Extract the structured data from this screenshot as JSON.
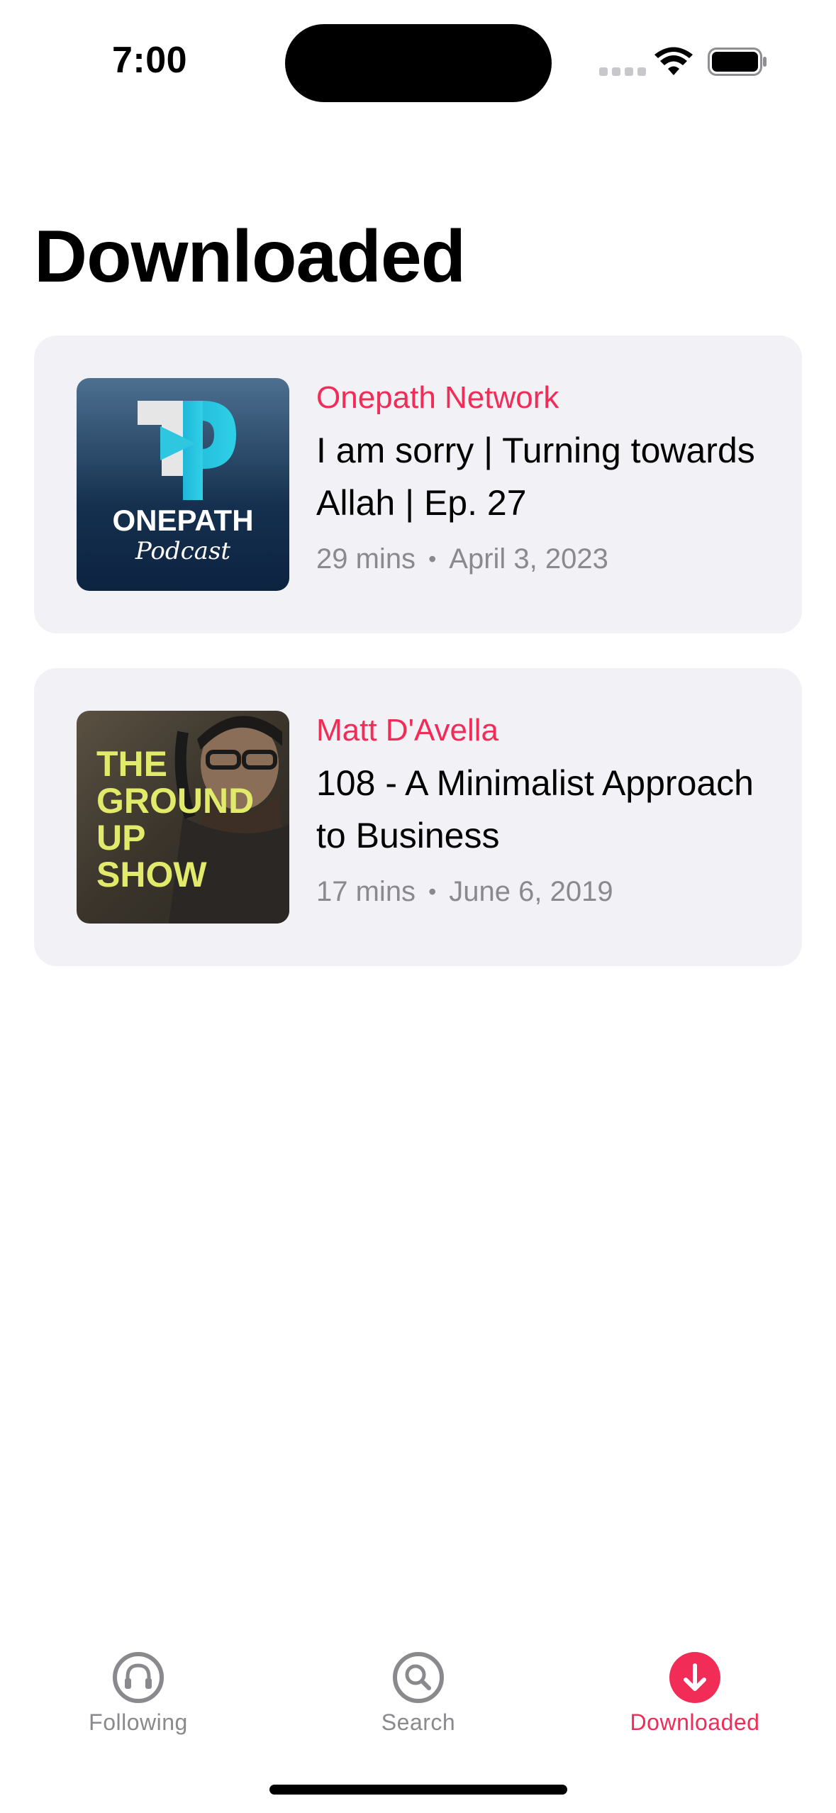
{
  "status_bar": {
    "time": "7:00"
  },
  "page": {
    "title": "Downloaded"
  },
  "episodes": [
    {
      "podcast": "Onepath Network",
      "title": "I am sorry | Turning towards Allah | Ep. 27",
      "duration": "29 mins",
      "date": "April 3, 2023",
      "artwork_text": [
        "ONEPATH",
        "Podcast"
      ]
    },
    {
      "podcast": "Matt D'Avella",
      "title": "108 - A Minimalist Approach to Business",
      "duration": "17 mins",
      "date": "June 6, 2019",
      "artwork_text": [
        "THE",
        "GROUND",
        "UP",
        "SHOW"
      ]
    }
  ],
  "meta_separator": "•",
  "tabs": [
    {
      "label": "Following",
      "icon": "headphones-icon",
      "active": false
    },
    {
      "label": "Search",
      "icon": "search-icon",
      "active": false
    },
    {
      "label": "Downloaded",
      "icon": "download-icon",
      "active": true
    }
  ],
  "colors": {
    "accent": "#f02c57",
    "card_background": "#f2f1f6",
    "secondary_text": "#8a8a8e"
  }
}
